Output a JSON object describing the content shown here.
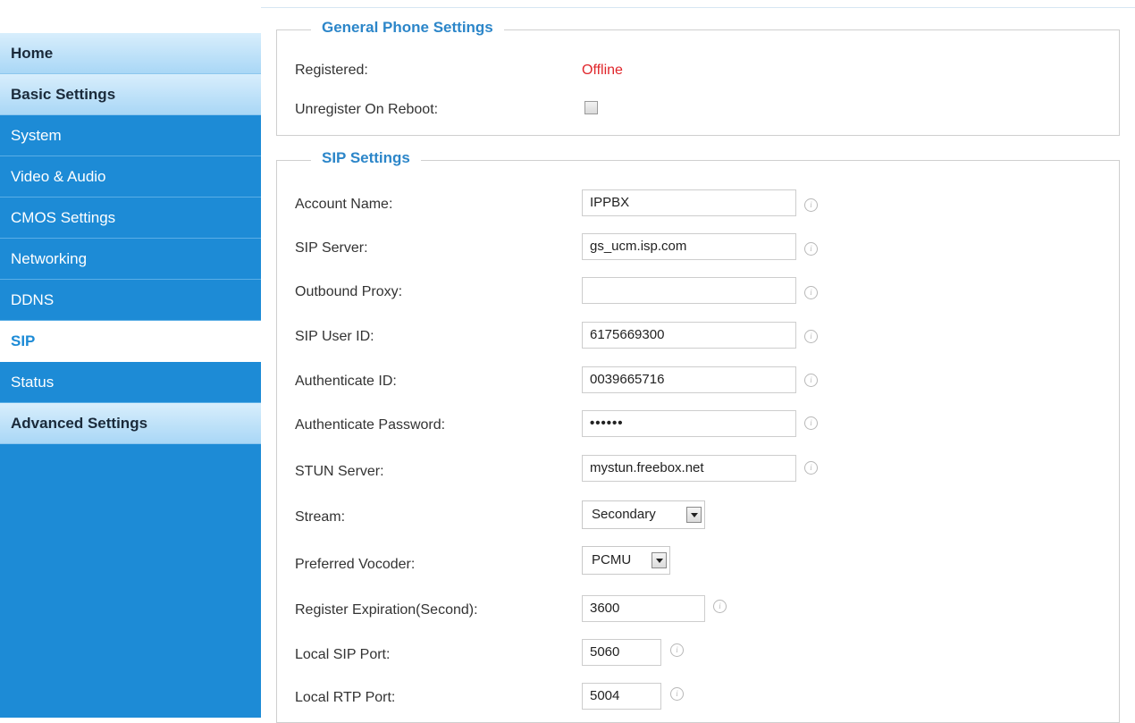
{
  "sidebar": {
    "items": [
      {
        "label": "Home"
      },
      {
        "label": "Basic Settings"
      },
      {
        "label": "System"
      },
      {
        "label": "Video & Audio"
      },
      {
        "label": "CMOS Settings"
      },
      {
        "label": "Networking"
      },
      {
        "label": "DDNS"
      },
      {
        "label": "SIP"
      },
      {
        "label": "Status"
      },
      {
        "label": "Advanced Settings"
      }
    ]
  },
  "general": {
    "title": "General Phone Settings",
    "registered_label": "Registered:",
    "registered_value": "Offline",
    "registered_color": "#e0262b",
    "unregister_label": "Unregister On Reboot:",
    "unregister_checked": false
  },
  "sip": {
    "title": "SIP Settings",
    "account_name": {
      "label": "Account Name:",
      "value": "IPPBX"
    },
    "sip_server": {
      "label": "SIP Server:",
      "value": "gs_ucm.isp.com"
    },
    "outbound_proxy": {
      "label": "Outbound Proxy:",
      "value": ""
    },
    "sip_user_id": {
      "label": "SIP User ID:",
      "value": "6175669300"
    },
    "authenticate_id": {
      "label": "Authenticate ID:",
      "value": "0039665716"
    },
    "authenticate_password": {
      "label": "Authenticate Password:",
      "value": "••••••"
    },
    "stun_server": {
      "label": "STUN Server:",
      "value": "mystun.freebox.net"
    },
    "stream": {
      "label": "Stream:",
      "value": "Secondary"
    },
    "preferred_vocoder": {
      "label": "Preferred Vocoder:",
      "value": "PCMU"
    },
    "register_expiration": {
      "label": "Register Expiration(Second):",
      "value": "3600"
    },
    "local_sip_port": {
      "label": "Local SIP Port:",
      "value": "5060"
    },
    "local_rtp_port": {
      "label": "Local RTP Port:",
      "value": "5004"
    }
  },
  "colors": {
    "sidebar_bg": "#1d8bd6",
    "accent": "#2c86c9"
  },
  "icons": {
    "info": "info-icon",
    "select_arrow": "chevron-down-icon"
  }
}
